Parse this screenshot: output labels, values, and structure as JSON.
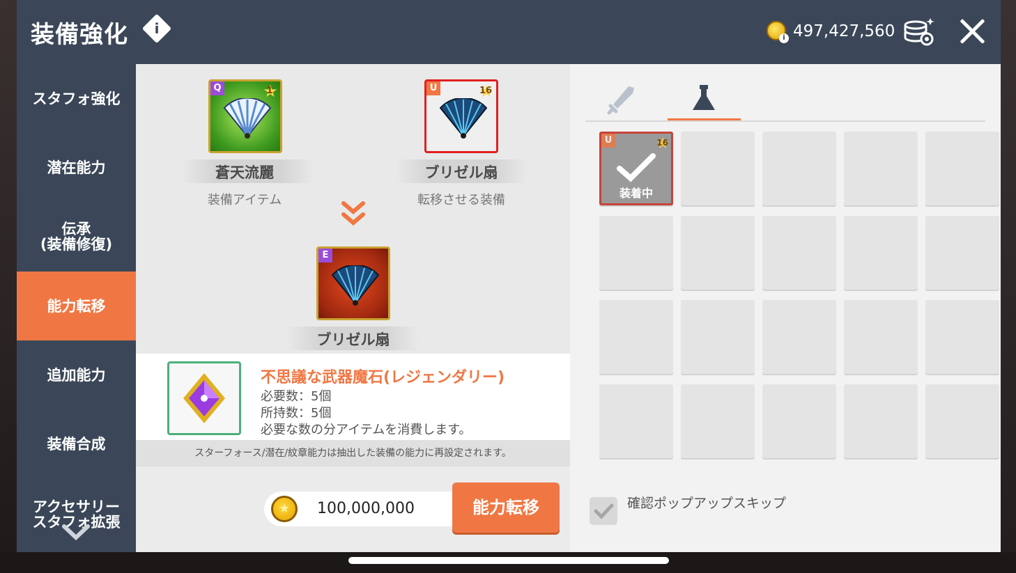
{
  "header": {
    "title": "装備強化",
    "info_label": "i",
    "currency_amount": "497,427,560"
  },
  "sidebar": {
    "items": [
      {
        "label": "スタフォ強化"
      },
      {
        "label": "潜在能力"
      },
      {
        "label": "伝承\n(装備修復)"
      },
      {
        "label": "能力転移"
      },
      {
        "label": "追加能力"
      },
      {
        "label": "装備合成"
      },
      {
        "label": "アクセサリー\nスタフォ拡張"
      }
    ],
    "active_index": 3
  },
  "transfer": {
    "source": {
      "name": "蒼天流麗",
      "sub": "装備アイテム",
      "grade": "Q",
      "stars": "1"
    },
    "target": {
      "name": "ブリゼル扇",
      "sub": "転移させる装備",
      "grade": "U",
      "stars": "16"
    },
    "result": {
      "name": "ブリゼル扇",
      "grade": "E"
    }
  },
  "material": {
    "name": "不思議な武器魔石(レジェンダリー)",
    "required": "必要数：5個",
    "owned": "所持数：5個",
    "note": "必要な数の分アイテムを消費します。"
  },
  "notice": "スターフォース/潜在/紋章能力は抽出した装備の能力に再設定されます。",
  "cost": {
    "value": "100,000,000"
  },
  "action_button": "能力転移",
  "inventory": {
    "tabs": [
      {
        "name": "weapon-tab",
        "icon": "sword-icon"
      },
      {
        "name": "consumable-tab",
        "icon": "potion-icon"
      }
    ],
    "active_tab": 1,
    "equipped_item": {
      "grade": "U",
      "stars": "16",
      "label": "装着中"
    },
    "rows": 4,
    "cols": 5
  },
  "skip_popup": {
    "label": "確認ポップアップスキップ",
    "checked": true
  },
  "colors": {
    "accent": "#f07743",
    "header": "#3b4758",
    "legendary_border": "#4caf7a"
  }
}
